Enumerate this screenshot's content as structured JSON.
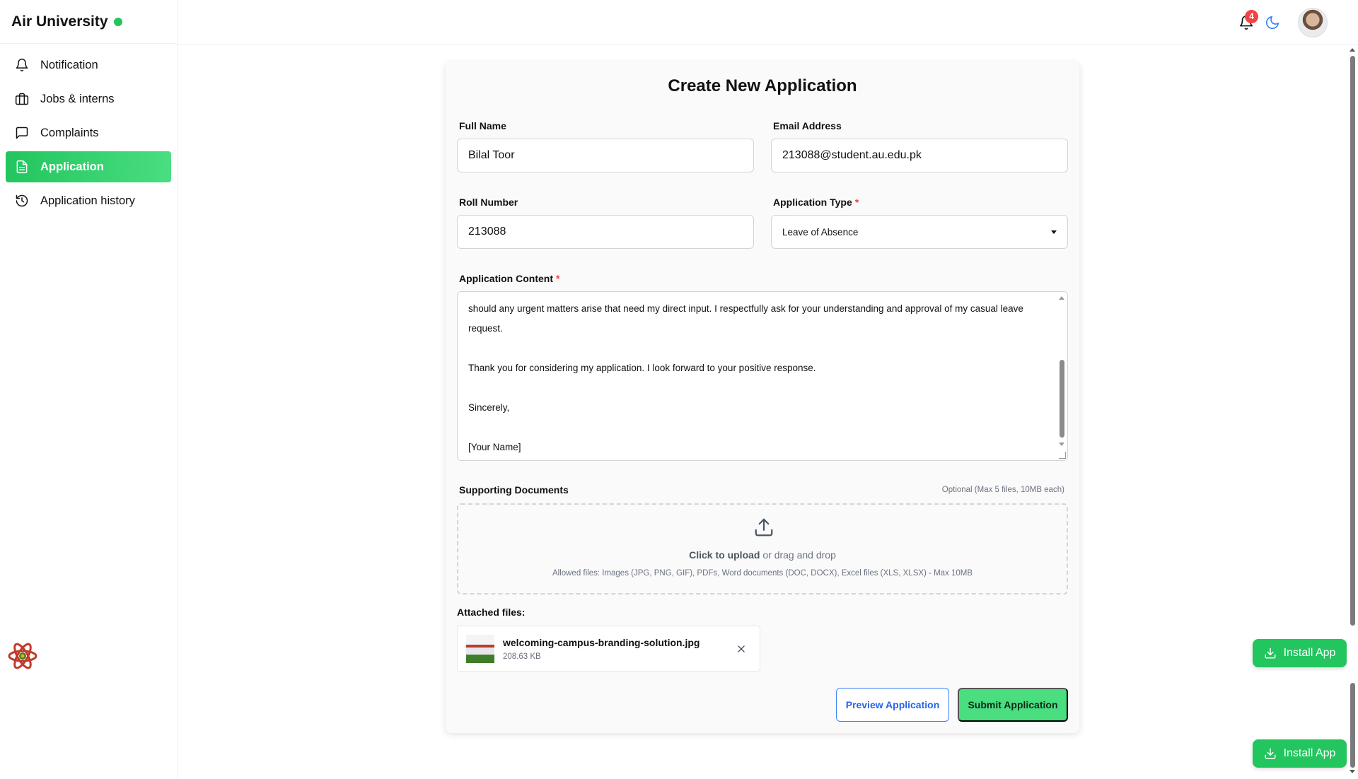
{
  "brand": {
    "name": "Air University",
    "status_color": "#22c55e"
  },
  "sidebar": {
    "items": [
      {
        "label": "Notification",
        "icon": "bell-icon"
      },
      {
        "label": "Jobs & interns",
        "icon": "briefcase-icon"
      },
      {
        "label": "Complaints",
        "icon": "message-square-icon"
      },
      {
        "label": "Application",
        "icon": "file-text-icon",
        "active": true
      },
      {
        "label": "Application history",
        "icon": "history-icon"
      }
    ],
    "accent": "#22c55e"
  },
  "header": {
    "notification_count": "4",
    "icons": [
      "bell-icon",
      "moon-icon",
      "avatar"
    ]
  },
  "form": {
    "title": "Create New Application",
    "full_name": {
      "label": "Full Name",
      "value": "Bilal Toor"
    },
    "email": {
      "label": "Email Address",
      "value": "213088@student.au.edu.pk"
    },
    "roll_number": {
      "label": "Roll Number",
      "value": "213088"
    },
    "application_type": {
      "label": "Application Type",
      "required_mark": "*",
      "value": "Leave of Absence"
    },
    "content": {
      "label": "Application Content",
      "required_mark": "*",
      "lines": [
        "should any urgent matters arise that need my direct input. I respectfully ask for your understanding and approval of my casual leave",
        "request.",
        "",
        "Thank you for considering my application. I look forward to your positive response.",
        "",
        "Sincerely,",
        "",
        "[Your Name]"
      ]
    },
    "documents": {
      "label": "Supporting Documents",
      "note": "Optional (Max 5 files, 10MB each)",
      "upload_action": "Click to upload",
      "upload_rest": " or drag and drop",
      "allowed": "Allowed files: Images (JPG, PNG, GIF), PDFs, Word documents (DOC, DOCX), Excel files (XLS, XLSX) - Max 10MB"
    },
    "attached": {
      "title": "Attached files:",
      "files": [
        {
          "name": "welcoming-campus-branding-solution.jpg",
          "size": "208.63 KB"
        }
      ]
    },
    "buttons": {
      "preview": "Preview Application",
      "submit": "Submit Application"
    }
  },
  "install_buttons": [
    "Install App",
    "Install App"
  ]
}
